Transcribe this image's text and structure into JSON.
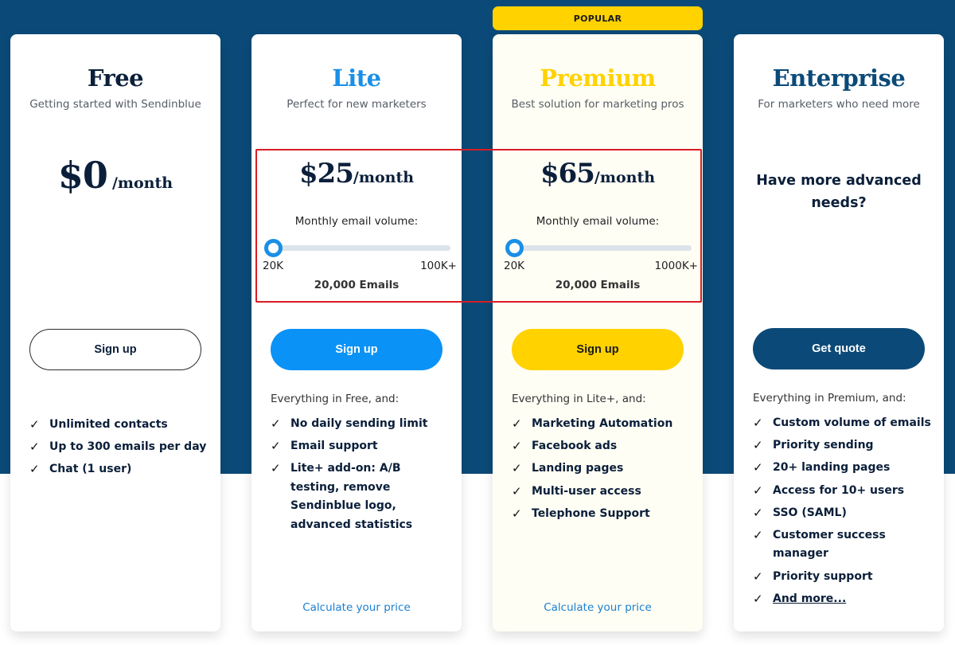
{
  "badge": {
    "popular": "POPULAR"
  },
  "colors": {
    "background_band": "#0b4a78",
    "lite_accent": "#0b92f7",
    "premium_accent": "#ffd200",
    "enterprise_accent": "#0b4a78",
    "highlight_border": "#d91c24"
  },
  "plans": {
    "free": {
      "name": "Free",
      "subtitle": "Getting started with Sendinblue",
      "price": "$0",
      "period": "/month",
      "button": "Sign up",
      "features": [
        "Unlimited contacts",
        "Up to 300 emails per day",
        "Chat (1 user)"
      ]
    },
    "lite": {
      "name": "Lite",
      "subtitle": "Perfect for new marketers",
      "price": "$25",
      "period": "/month",
      "volume_label": "Monthly email volume:",
      "slider": {
        "min_label": "20K",
        "max_label": "100K+",
        "value_fraction": 0
      },
      "volume_value": "20,000 Emails",
      "button": "Sign up",
      "intro": "Everything in Free, and:",
      "features": [
        "No daily sending limit",
        "Email support",
        "Lite+ add-on: A/B testing, remove Sendinblue logo, advanced statistics"
      ],
      "calc_link": "Calculate your price"
    },
    "premium": {
      "name": "Premium",
      "subtitle": "Best solution for marketing pros",
      "price": "$65",
      "period": "/month",
      "volume_label": "Monthly email volume:",
      "slider": {
        "min_label": "20K",
        "max_label": "1000K+",
        "value_fraction": 0
      },
      "volume_value": "20,000 Emails",
      "button": "Sign up",
      "intro": "Everything in Lite+, and:",
      "features": [
        "Marketing Automation",
        "Facebook ads",
        "Landing pages",
        "Multi-user access",
        "Telephone Support"
      ],
      "calc_link": "Calculate your price"
    },
    "enterprise": {
      "name": "Enterprise",
      "subtitle": "For marketers who need more",
      "needs": "Have more advanced needs?",
      "button": "Get quote",
      "intro": "Everything in Premium, and:",
      "features": [
        "Custom volume of emails",
        "Priority sending",
        "20+ landing pages",
        "Access for 10+ users",
        "SSO (SAML)",
        "Customer success manager",
        "Priority support"
      ],
      "more_link": "And more...",
      "check_icon": "checkmark-icon"
    }
  },
  "icons": {
    "check": "✓"
  }
}
